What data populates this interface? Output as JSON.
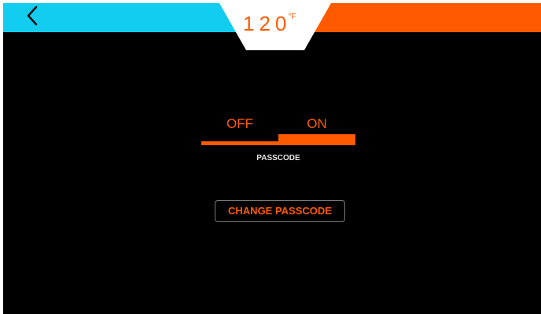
{
  "header": {
    "back_icon": "chevron-left-icon",
    "temperature": {
      "value": "120",
      "unit": "°F"
    },
    "colors": {
      "left_band": "#12cdf0",
      "right_band": "#ff5a00",
      "badge": "#ffffff",
      "temperature_text": "#ff5a00"
    }
  },
  "passcode_toggle": {
    "off_label": "OFF",
    "on_label": "ON",
    "state": "ON",
    "caption": "PASSCODE",
    "accent": "#ff5a00"
  },
  "change_passcode": {
    "label": "CHANGE PASSCODE"
  },
  "background_color": "#000000"
}
